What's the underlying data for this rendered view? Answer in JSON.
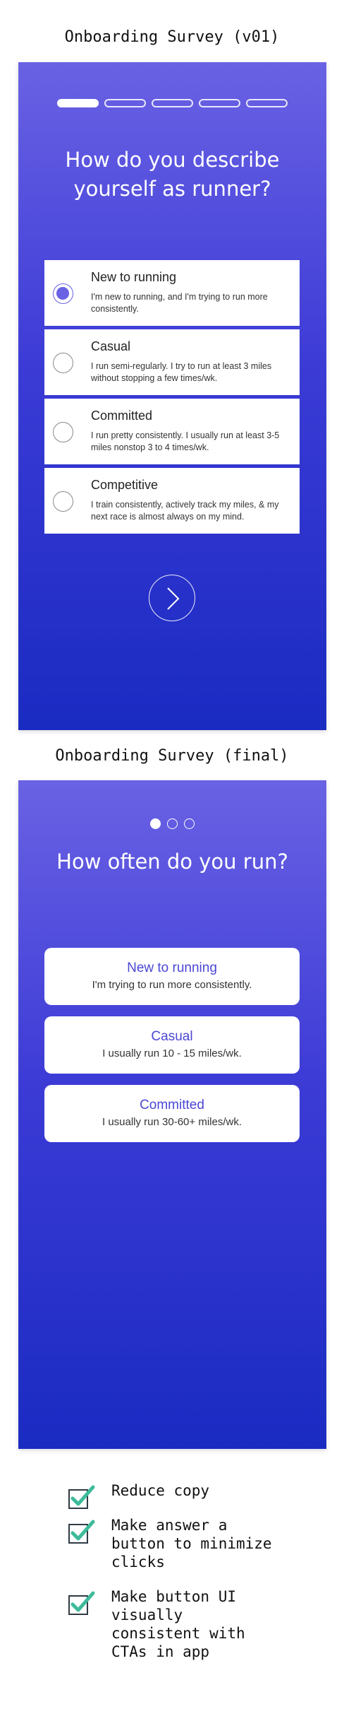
{
  "caption_v01": "Onboarding Survey (v01)",
  "caption_final": "Onboarding Survey (final)",
  "v01": {
    "progress": {
      "total": 5,
      "active_index": 0
    },
    "question": "How do you describe yourself as runner?",
    "options": [
      {
        "title": "New to running",
        "description": "I'm new to running, and I'm trying to run more consistently.",
        "selected": true
      },
      {
        "title": "Casual",
        "description": "I run semi-regularly. I try to run at least 3 miles without stopping a few times/wk.",
        "selected": false
      },
      {
        "title": "Committed",
        "description": "I run pretty consistently. I usually run at least 3-5 miles nonstop 3 to 4 times/wk.",
        "selected": false
      },
      {
        "title": "Competitive",
        "description": "I train consistently, actively track my miles, & my next race is almost always on my mind.",
        "selected": false
      }
    ],
    "next_icon": "chevron-right-icon"
  },
  "final": {
    "pager": {
      "total": 3,
      "active_index": 0
    },
    "question": "How often do you run?",
    "options": [
      {
        "title": "New to running",
        "description": "I'm trying to run more consistently."
      },
      {
        "title": "Casual",
        "description": "I usually run 10 - 15 miles/wk."
      },
      {
        "title": "Committed",
        "description": "I usually run 30-60+ miles/wk."
      }
    ]
  },
  "checklist": [
    {
      "text": "Reduce copy",
      "icon": "checkbox-checked-icon"
    },
    {
      "text": "Make answer a button to minimize clicks",
      "icon": "checkbox-checked-icon"
    },
    {
      "text": "Make button UI visually consistent with CTAs in app",
      "icon": "checkbox-checked-icon"
    }
  ],
  "colors": {
    "gradient_top": "#6a62e4",
    "gradient_bottom": "#1a2bc2",
    "accent_text": "#4a47d4",
    "check_green": "#3dbb9a"
  }
}
